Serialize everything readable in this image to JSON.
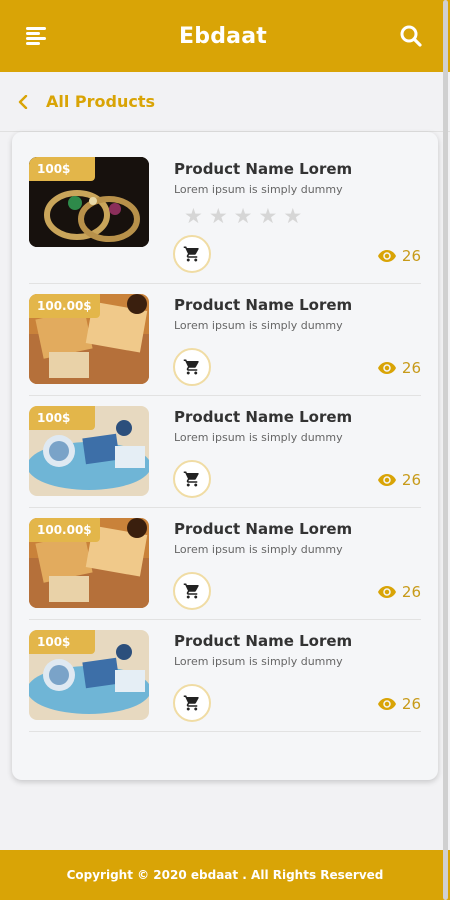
{
  "header": {
    "title": "Ebdaat",
    "menu_icon": "hamburger-icon",
    "search_icon": "search-icon"
  },
  "breadcrumb": {
    "label": "All Products",
    "back_icon": "chevron-left-icon"
  },
  "colors": {
    "brand": "#d9a406",
    "price_tag": "#e3b64a"
  },
  "products": [
    {
      "price": "100$",
      "name": "Product Name Lorem",
      "desc": "Lorem ipsum is simply dummy",
      "views": "26",
      "rating_stars": 0,
      "image": "jewelry-rings"
    },
    {
      "price": "100.00$",
      "name": "Product Name Lorem",
      "desc": "Lorem ipsum is simply dummy",
      "views": "26",
      "image": "gift-boxes"
    },
    {
      "price": "100$",
      "name": "Product Name Lorem",
      "desc": "Lorem ipsum is simply dummy",
      "views": "26",
      "image": "blue-gifts"
    },
    {
      "price": "100.00$",
      "name": "Product Name Lorem",
      "desc": "Lorem ipsum is simply dummy",
      "views": "26",
      "image": "gift-boxes"
    },
    {
      "price": "100$",
      "name": "Product Name Lorem",
      "desc": "Lorem ipsum is simply dummy",
      "views": "26",
      "image": "blue-gifts"
    }
  ],
  "footer": {
    "copyright": "Copyright © 2020 ebdaat . All Rights Reserved"
  }
}
